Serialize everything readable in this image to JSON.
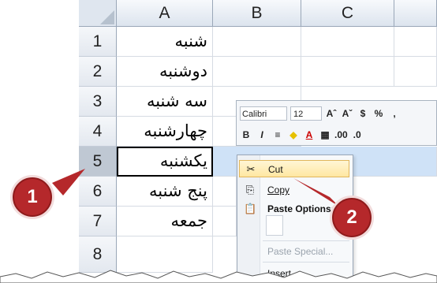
{
  "columns": [
    "A",
    "B",
    "C"
  ],
  "rows": [
    {
      "num": "1",
      "a": "شنبه"
    },
    {
      "num": "2",
      "a": "دوشنبه"
    },
    {
      "num": "3",
      "a": "سه شنبه"
    },
    {
      "num": "4",
      "a": "چهارشنبه"
    },
    {
      "num": "5",
      "a": "یکشنبه"
    },
    {
      "num": "6",
      "a": "پنج شنبه"
    },
    {
      "num": "7",
      "a": "جمعه"
    },
    {
      "num": "8",
      "a": ""
    }
  ],
  "mini_toolbar": {
    "font": "Calibri",
    "size": "12",
    "grow": "Aˆ",
    "shrink": "Aˇ",
    "currency": "$",
    "percent": "%",
    "comma": ",",
    "bold": "B",
    "italic": "I",
    "align": "≡",
    "fill": "◆",
    "font_color": "A",
    "border": "▦",
    "inc_dec": ".00",
    "dec_dec": ".0"
  },
  "context_menu": {
    "cut": "Cut",
    "copy": "Copy",
    "paste_options": "Paste Options:",
    "paste_special": "Paste Special...",
    "insert": "Insert"
  },
  "callouts": {
    "one": "1",
    "two": "2"
  },
  "colors": {
    "badge": "#b5282b",
    "selected_row": "#cfe2f7"
  }
}
